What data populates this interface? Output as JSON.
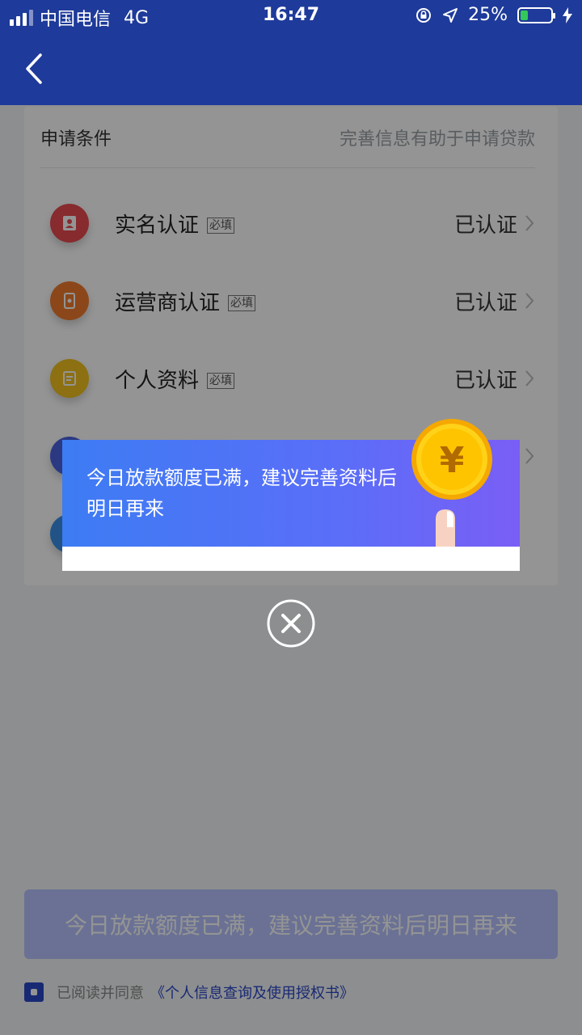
{
  "status_bar": {
    "carrier": "中国电信",
    "network": "4G",
    "time": "16:47",
    "battery": "25%",
    "battery_level": 0.25
  },
  "card": {
    "title": "申请条件",
    "hint": "完善信息有助于申请贷款",
    "rows": [
      {
        "label": "实名认证",
        "tag": "必填",
        "status": "已认证",
        "icon": "id-card-icon",
        "color": "#e84a50"
      },
      {
        "label": "运营商认证",
        "tag": "必填",
        "status": "已认证",
        "icon": "phone-icon",
        "color": "#f07a2e"
      },
      {
        "label": "个人资料",
        "tag": "必填",
        "status": "已认证",
        "icon": "profile-doc-icon",
        "color": "#f2c21e"
      }
    ]
  },
  "modal": {
    "message": "今日放款额度已满，建议完善资料后明日再来",
    "coin_symbol": "¥"
  },
  "main_button": {
    "label": "今日放款额度已满，建议完善资料后明日再来"
  },
  "agreement": {
    "text": "已阅读并同意",
    "link": "《个人信息查询及使用授权书》",
    "checked": true
  }
}
